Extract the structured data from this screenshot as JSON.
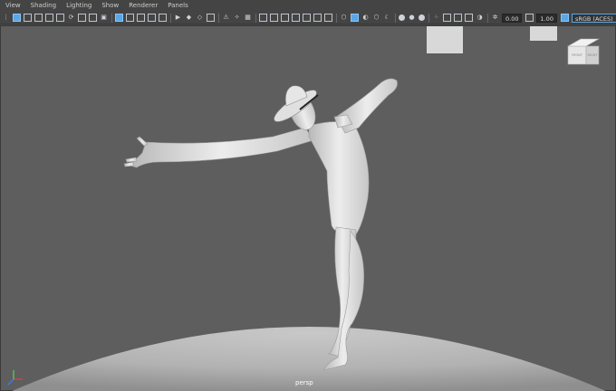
{
  "menubar": {
    "items": [
      {
        "label": "View"
      },
      {
        "label": "Shading"
      },
      {
        "label": "Lighting"
      },
      {
        "label": "Show"
      },
      {
        "label": "Renderer"
      },
      {
        "label": "Panels"
      }
    ]
  },
  "toolbar": {
    "field_a": "0.00",
    "field_b": "1.00",
    "color_space": "sRGB (ACES)"
  },
  "viewport": {
    "camera_label": "persp",
    "background_color": "#5e5e5e",
    "ground_color": "#bdbdbd"
  },
  "viewcube": {
    "front_label": "FRONT",
    "right_label": "RIGHT"
  },
  "axis_gizmo": {
    "x_color": "#e04040",
    "y_color": "#60d060",
    "z_color": "#4080ff"
  }
}
